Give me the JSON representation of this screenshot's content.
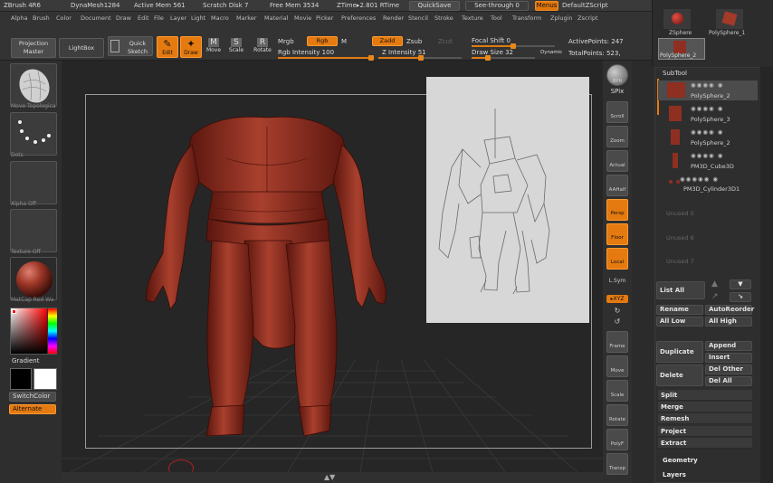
{
  "titlebar": {
    "app": "ZBrush 4R6",
    "dynamesh": "DynaMesh1284",
    "active_mem": "Active Mem 561",
    "scratch_disk": "Scratch Disk 7",
    "free_mem": "Free Mem 3534",
    "ztime": "ZTime▸2.801 RTime",
    "quicksave": "QuickSave",
    "see_through": "See-through  0",
    "menus": "Menus",
    "script": "DefaultZScript"
  },
  "menubar": [
    "Alpha",
    "Brush",
    "Color",
    "Document",
    "Draw",
    "Edit",
    "File",
    "Layer",
    "Light",
    "Macro",
    "Marker",
    "Material",
    "Movie",
    "Picker",
    "Preferences",
    "Render",
    "Stencil",
    "Stroke",
    "Texture",
    "Tool",
    "Transform",
    "Zplugin",
    "Zscript"
  ],
  "toolbar": {
    "projection_master": "Projection Master",
    "lightbox": "LightBox",
    "quick_sketch": "Quick Sketch",
    "edit": "Edit",
    "draw": "Draw",
    "move": "Move",
    "scale": "Scale",
    "rotate": "Rotate",
    "mrgb": "Mrgb",
    "rgb": "Rgb",
    "m": "M",
    "rgb_intensity": "Rgb Intensity 100",
    "zadd": "Zadd",
    "zsub": "Zsub",
    "zcut": "Zcut",
    "z_intensity": "Z Intensity 51",
    "focal_shift": "Focal Shift 0",
    "draw_size": "Draw Size 32",
    "dynamic": "Dynamic",
    "active_points": "ActivePoints: 247",
    "total_points": "TotalPoints: 523,"
  },
  "leftshelf": {
    "brush_label": "Move Topologica",
    "stroke_label": "Dots",
    "alpha_label": "Alpha Off",
    "texture_label": "Texture Off",
    "material_label": "MatCap Red Wa",
    "gradient": "Gradient",
    "switchcolor": "SwitchColor",
    "alternate": "Alternate"
  },
  "righttools": {
    "bpr": "BPR",
    "spix": "SPix",
    "scroll": "Scroll",
    "zoom": "Zoom",
    "actual": "Actual",
    "aahalf": "AAHalf",
    "persp": "Persp",
    "floor": "Floor",
    "local": "Local",
    "lsym": "L.Sym",
    "xyz": "▸XYZ",
    "frame": "Frame",
    "move": "Move",
    "scale": "Scale",
    "rotate": "Rotate",
    "polyf": "PolyF",
    "transp": "Transp"
  },
  "traytop": {
    "zsphere": "ZSphere",
    "polysphere1": "PolySphere_1",
    "polysphere2": "PolySphere_2"
  },
  "subtool": {
    "title": "SubTool",
    "items": [
      {
        "name": "PolySphere_2"
      },
      {
        "name": "PolySphere_3"
      },
      {
        "name": "PolySphere_2"
      },
      {
        "name": "PM3D_Cube3D"
      },
      {
        "name": "PM3D_Cylinder3D1"
      }
    ],
    "unused": [
      "Unused 5",
      "Unused 6",
      "Unused 7"
    ],
    "list_all": "List All",
    "rename": "Rename",
    "autoreorder": "AutoReorder",
    "all_low": "All Low",
    "all_high": "All High",
    "duplicate": "Duplicate",
    "append": "Append",
    "insert": "Insert",
    "delete": "Delete",
    "del_other": "Del Other",
    "del_all": "Del All",
    "split": "Split",
    "merge": "Merge",
    "remesh": "Remesh",
    "project": "Project",
    "extract": "Extract",
    "geometry": "Geometry",
    "layers": "Layers"
  },
  "sliders": {
    "rgb_intensity": 1.0,
    "z_intensity": 0.51,
    "focal_shift": 0.5,
    "draw_size": 0.25
  },
  "colors": {
    "accent": "#e57a10",
    "model": "#8e2f22",
    "panel": "#2e2e2e"
  }
}
